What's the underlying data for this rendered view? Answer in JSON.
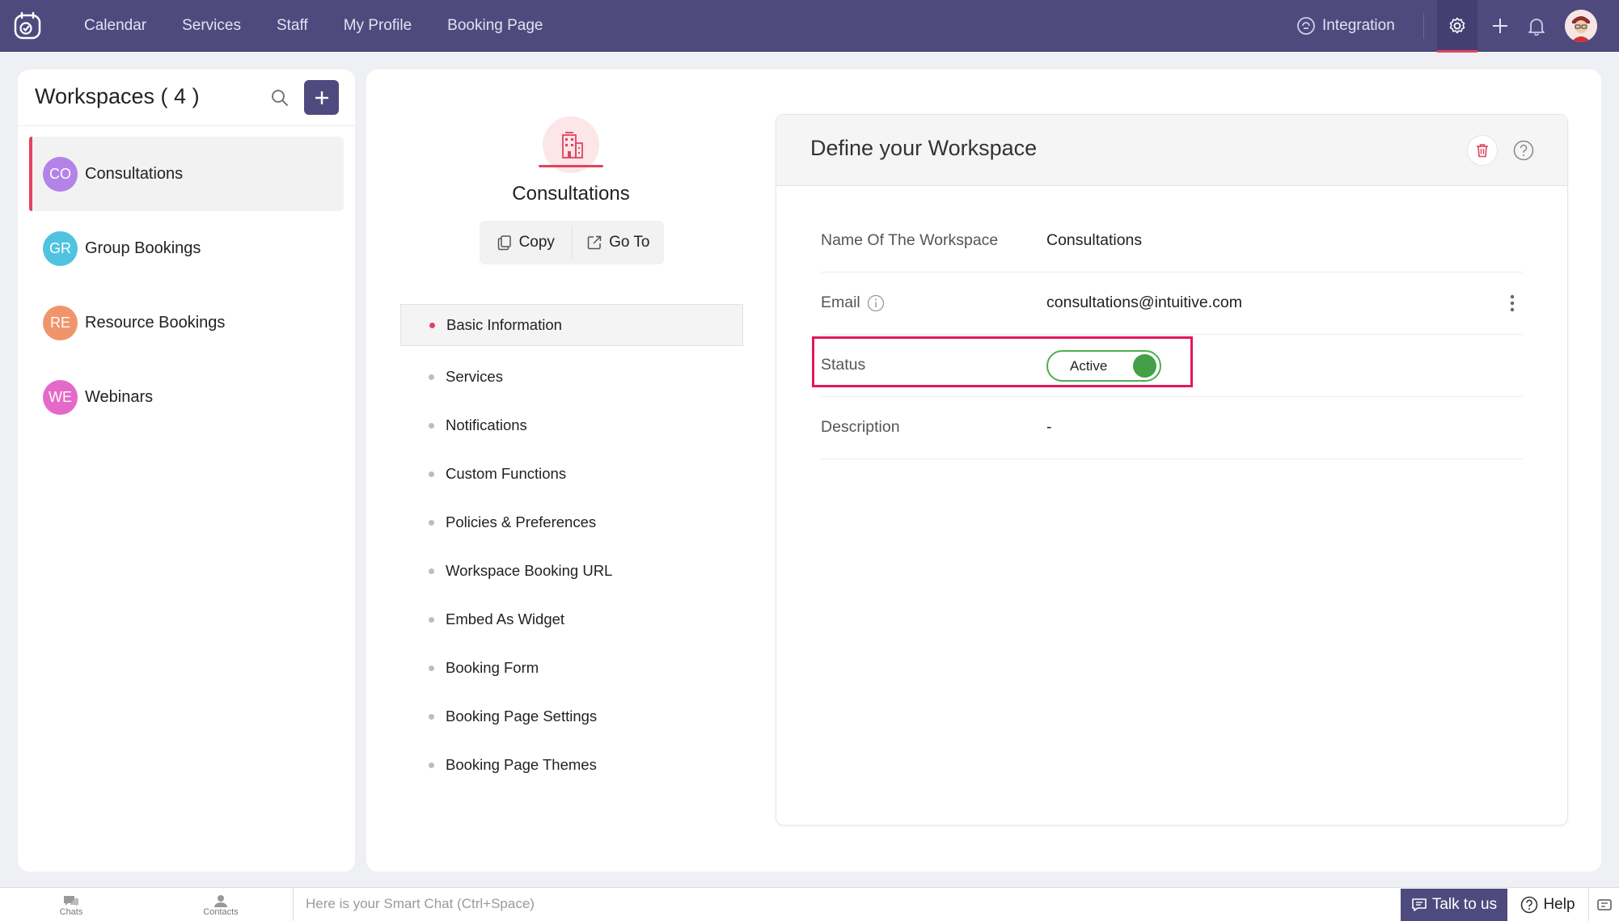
{
  "nav": {
    "items": [
      "Calendar",
      "Services",
      "Staff",
      "My Profile",
      "Booking Page"
    ],
    "integration": "Integration"
  },
  "workspaces": {
    "title": "Workspaces ( 4 )",
    "items": [
      {
        "initials": "CO",
        "label": "Consultations",
        "color": "#b383e8"
      },
      {
        "initials": "GR",
        "label": "Group Bookings",
        "color": "#4fc3e0"
      },
      {
        "initials": "RE",
        "label": "Resource Bookings",
        "color": "#f0956b"
      },
      {
        "initials": "WE",
        "label": "Webinars",
        "color": "#e569c9"
      }
    ]
  },
  "workspace": {
    "name": "Consultations",
    "copy_label": "Copy",
    "goto_label": "Go To"
  },
  "menu": {
    "items": [
      "Basic Information",
      "Services",
      "Notifications",
      "Custom Functions",
      "Policies & Preferences",
      "Workspace Booking URL",
      "Embed As Widget",
      "Booking Form",
      "Booking Page Settings",
      "Booking Page Themes"
    ]
  },
  "define": {
    "title": "Define your Workspace",
    "fields": {
      "name_label": "Name Of The Workspace",
      "name_value": "Consultations",
      "email_label": "Email",
      "email_value": "consultations@intuitive.com",
      "status_label": "Status",
      "status_value": "Active",
      "description_label": "Description",
      "description_value": "-"
    }
  },
  "bottom": {
    "chats": "Chats",
    "contacts": "Contacts",
    "smartchat_placeholder": "Here is your Smart Chat (Ctrl+Space)",
    "talk": "Talk to us",
    "help": "Help"
  },
  "colors": {
    "brand": "#4f4a7e",
    "accent": "#e0445e",
    "active_green": "#43a047",
    "highlight": "#e2175e"
  }
}
